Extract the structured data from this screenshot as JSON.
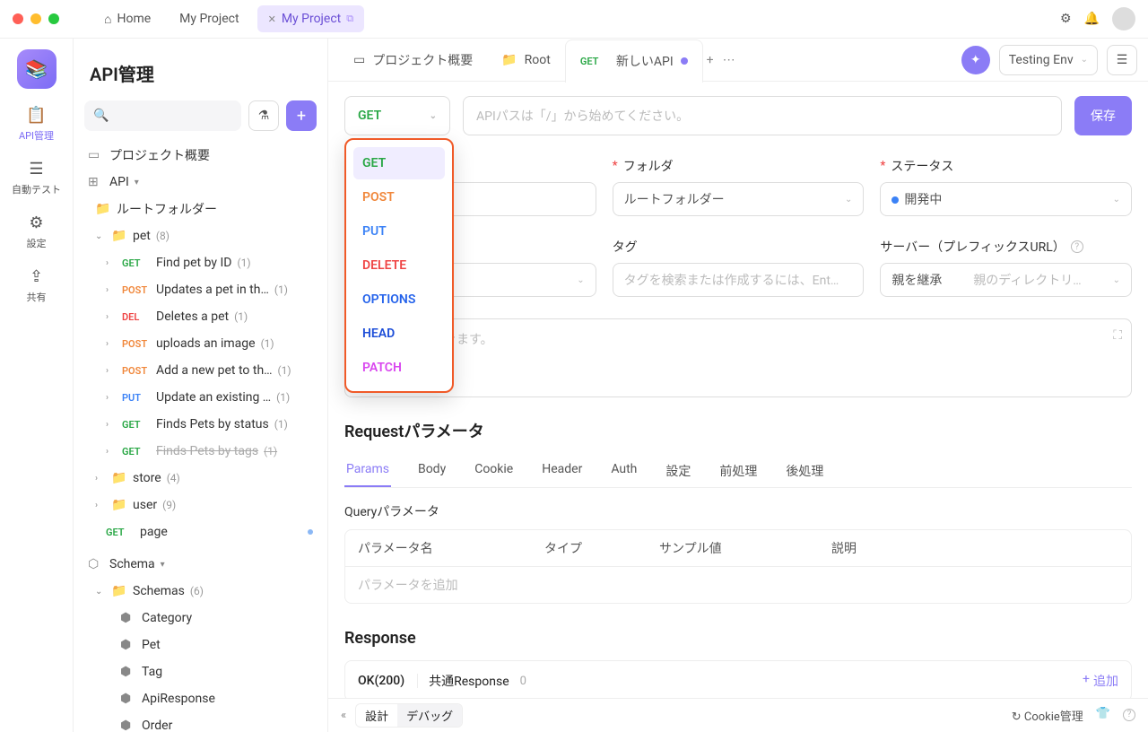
{
  "titlebar": {
    "home": "Home",
    "tabs": [
      "My Project",
      "My Project"
    ]
  },
  "rail": {
    "items": [
      {
        "label": "API管理"
      },
      {
        "label": "自動テスト"
      },
      {
        "label": "設定"
      },
      {
        "label": "共有"
      }
    ]
  },
  "sidebar": {
    "title": "API管理",
    "project_overview": "プロジェクト概要",
    "api_label": "API",
    "root_folder": "ルートフォルダー",
    "pet": {
      "name": "pet",
      "count": "(8)"
    },
    "pet_items": [
      {
        "method": "GET",
        "name": "Find pet by ID",
        "count": "(1)"
      },
      {
        "method": "POST",
        "name": "Updates a pet in th…",
        "count": "(1)"
      },
      {
        "method": "DEL",
        "name": "Deletes a pet",
        "count": "(1)"
      },
      {
        "method": "POST",
        "name": "uploads an image",
        "count": "(1)"
      },
      {
        "method": "POST",
        "name": "Add a new pet to th…",
        "count": "(1)"
      },
      {
        "method": "PUT",
        "name": "Update an existing …",
        "count": "(1)"
      },
      {
        "method": "GET",
        "name": "Finds Pets by status",
        "count": "(1)"
      },
      {
        "method": "GET",
        "name": "Finds Pets by tags",
        "count": "(1)",
        "struck": true
      }
    ],
    "store": {
      "name": "store",
      "count": "(4)"
    },
    "user": {
      "name": "user",
      "count": "(9)"
    },
    "page_item": {
      "method": "GET",
      "name": "page"
    },
    "schema_label": "Schema",
    "schemas": {
      "name": "Schemas",
      "count": "(6)"
    },
    "schema_items": [
      "Category",
      "Pet",
      "Tag",
      "ApiResponse",
      "Order"
    ]
  },
  "main_tabs": {
    "overview": "プロジェクト概要",
    "root": "Root",
    "new_api": {
      "method": "GET",
      "label": "新しいAPI"
    },
    "env": "Testing Env"
  },
  "editor": {
    "method": "GET",
    "url_placeholder": "APIパスは「/」から始めてください。",
    "save": "保存",
    "dropdown": [
      "GET",
      "POST",
      "PUT",
      "DELETE",
      "OPTIONS",
      "HEAD",
      "PATCH"
    ],
    "fields": {
      "folder_label": "フォルダ",
      "folder_value": "ルートフォルダー",
      "status_label": "ステータス",
      "status_value": "開発中",
      "tag_label": "タグ",
      "tag_placeholder": "タグを検索または作成するには、Ent…",
      "server_label": "サーバー（プレフィックスURL）",
      "server_value": "親を継承",
      "server_hint": "親のディレクトリ…"
    },
    "desc_placeholder": "マットが使用できます。",
    "request_header": "Requestパラメータ",
    "subtabs": [
      "Params",
      "Body",
      "Cookie",
      "Header",
      "Auth",
      "設定",
      "前処理",
      "後処理"
    ],
    "query_title": "Queryパラメータ",
    "param_cols": [
      "パラメータ名",
      "タイプ",
      "サンプル値",
      "説明"
    ],
    "param_empty": "パラメータを追加",
    "response_header": "Response",
    "response_ok": "OK(200)",
    "response_common": "共通Response",
    "response_common_count": "0",
    "response_add": "追加"
  },
  "footer": {
    "design": "設計",
    "debug": "デバッグ",
    "cookie": "Cookie管理"
  }
}
